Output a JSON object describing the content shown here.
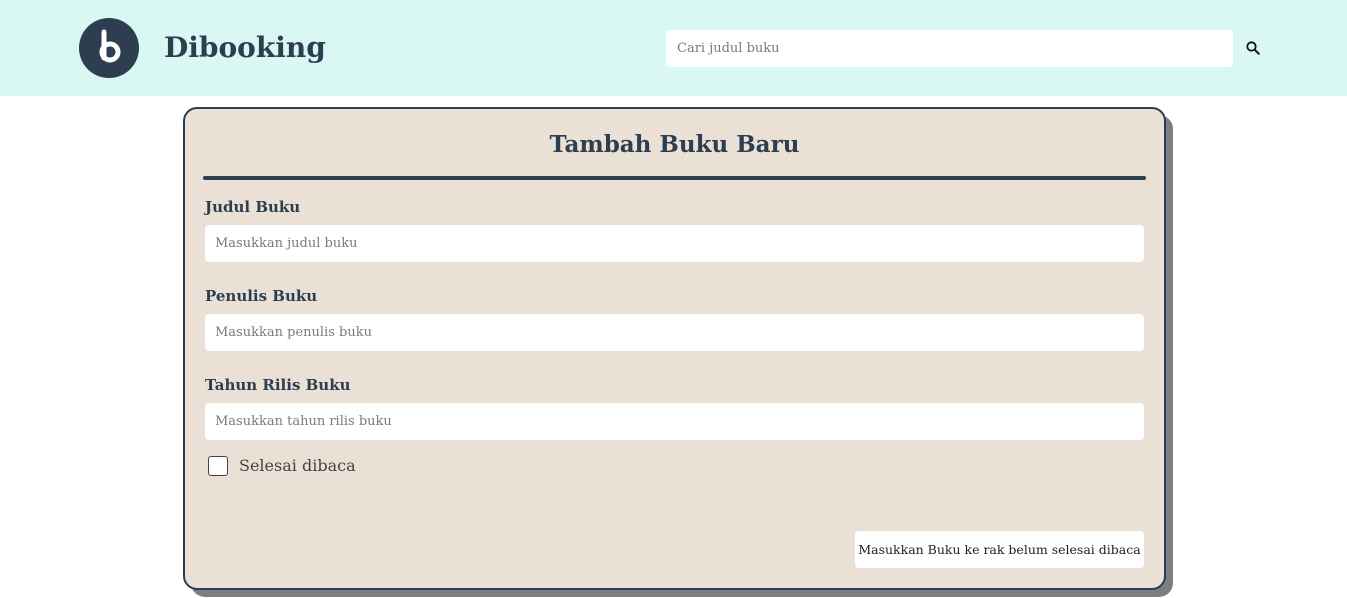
{
  "header": {
    "brand": "Dibooking",
    "logo_letter": "b",
    "search": {
      "placeholder": "Cari judul buku",
      "value": ""
    },
    "icons": {
      "search": "search-icon"
    }
  },
  "form": {
    "title": "Tambah Buku Baru",
    "fields": [
      {
        "label": "Judul Buku",
        "placeholder": "Masukkan judul buku",
        "value": ""
      },
      {
        "label": "Penulis Buku",
        "placeholder": "Masukkan penulis buku",
        "value": ""
      },
      {
        "label": "Tahun Rilis Buku",
        "placeholder": "Masukkan tahun rilis buku",
        "value": ""
      }
    ],
    "checkbox": {
      "label": "Selesai dibaca",
      "checked": false
    },
    "submit_label": "Masukkan Buku ke rak belum selesai dibaca"
  },
  "colors": {
    "header_bg": "#d9f7f3",
    "primary": "#2d3e50",
    "card_bg": "#ebe0d5",
    "card_shadow": "#7b7f82"
  }
}
